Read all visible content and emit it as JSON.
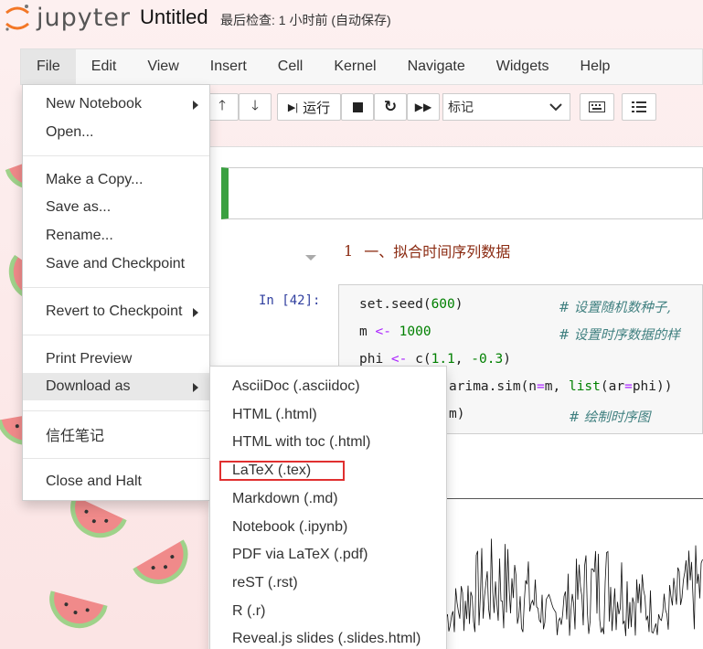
{
  "header": {
    "logo_text": "jupyter",
    "title": "Untitled",
    "checkpoint_status": "最后检查: 1 小时前  (自动保存)"
  },
  "menubar": {
    "items": [
      {
        "label": "File"
      },
      {
        "label": "Edit"
      },
      {
        "label": "View"
      },
      {
        "label": "Insert"
      },
      {
        "label": "Cell"
      },
      {
        "label": "Kernel"
      },
      {
        "label": "Navigate"
      },
      {
        "label": "Widgets"
      },
      {
        "label": "Help"
      }
    ]
  },
  "toolbar": {
    "run_label": "运行",
    "cell_type_value": "标记"
  },
  "file_menu": {
    "items": [
      {
        "label": "New Notebook"
      },
      {
        "label": "Open..."
      },
      {
        "label": "Make a Copy..."
      },
      {
        "label": "Save as..."
      },
      {
        "label": "Rename..."
      },
      {
        "label": "Save and Checkpoint"
      },
      {
        "label": "Revert to Checkpoint"
      },
      {
        "label": "Print Preview"
      },
      {
        "label": "Download as"
      },
      {
        "label": "信任笔记"
      },
      {
        "label": "Close and Halt"
      }
    ]
  },
  "download_menu": {
    "items": [
      {
        "label": "AsciiDoc (.asciidoc)"
      },
      {
        "label": "HTML (.html)"
      },
      {
        "label": "HTML with toc (.html)"
      },
      {
        "label": "LaTeX (.tex)"
      },
      {
        "label": "Markdown (.md)"
      },
      {
        "label": "Notebook (.ipynb)"
      },
      {
        "label": "PDF via LaTeX (.pdf)"
      },
      {
        "label": "reST (.rst)"
      },
      {
        "label": "R (.r)"
      },
      {
        "label": "Reveal.js slides (.slides.html)"
      }
    ]
  },
  "notebook": {
    "heading_number": "1",
    "heading_text": "一、拟合时间序列数据",
    "prompt": "In  [42]:",
    "code": {
      "l1a": "set.seed(",
      "l1n": "600",
      "l1b": ")",
      "l1c": "# 设置随机数种子,",
      "l2a": "m ",
      "l2op": "<-",
      "l2n": " 1000",
      "l2c": "# 设置时序数据的样",
      "l3a": "phi ",
      "l3op": "<-",
      "l3b": " c(",
      "l3n1": "1.1",
      "l3s": ", ",
      "l3n2": "-0.3",
      "l3e": ")",
      "l4a": "arima.sim(n",
      "l4op": "=",
      "l4b": "m, ",
      "l4fn": "list",
      "l4c": "(ar",
      "l4op2": "=",
      "l4d": "phi))",
      "l5a": "m)",
      "l5c": "# 绘制时序图"
    }
  },
  "colors": {
    "accent_green": "#3aa041",
    "highlight_red": "#e03030",
    "heading_color": "#8b2b12"
  }
}
